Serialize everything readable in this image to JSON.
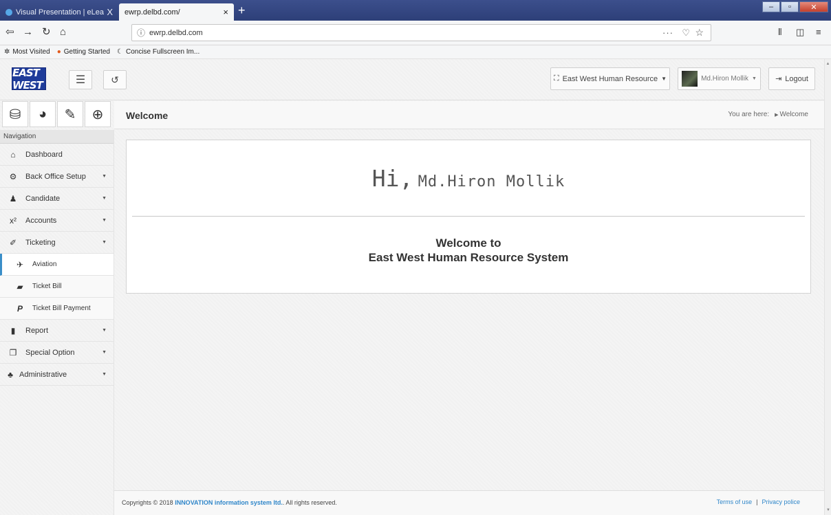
{
  "browser": {
    "tabs": [
      {
        "label": "Visual Presentation | eLearning",
        "close": "X"
      },
      {
        "label": "ewrp.delbd.com/",
        "close": "×"
      }
    ],
    "new_tab": "+",
    "url": "ewrp.delbd.com",
    "page_actions": "···",
    "bookmarks": [
      "Most Visited",
      "Getting Started",
      "Concise Fullscreen Im..."
    ]
  },
  "topbar": {
    "organization": "East West Human Resource",
    "user_name": "Md.Hiron Mollik",
    "logout_label": "Logout",
    "logo_text": "EAST WEST"
  },
  "sidebar": {
    "header": "Navigation",
    "items": [
      {
        "label": "Dashboard",
        "icon": "home-icon",
        "has_sub": false
      },
      {
        "label": "Back Office Setup",
        "icon": "cogs-icon",
        "has_sub": true
      },
      {
        "label": "Candidate",
        "icon": "candidate-icon",
        "has_sub": true
      },
      {
        "label": "Accounts",
        "icon": "superscript-icon",
        "has_sub": true
      },
      {
        "label": "Ticketing",
        "icon": "ticket-icon",
        "has_sub": true
      },
      {
        "label": "Aviation",
        "icon": "plane-icon",
        "sub": true,
        "active": true
      },
      {
        "label": "Ticket Bill",
        "icon": "briefcase-icon",
        "sub": true
      },
      {
        "label": "Ticket Bill Payment",
        "icon": "paypal-icon",
        "sub": true
      },
      {
        "label": "Report",
        "icon": "book-icon",
        "has_sub": true
      },
      {
        "label": "Special Option",
        "icon": "copy-icon",
        "has_sub": true
      },
      {
        "label": "Administrative",
        "icon": "users-icon",
        "has_sub": true
      }
    ]
  },
  "content": {
    "title": "Welcome",
    "breadcrumb_label": "You are here:",
    "breadcrumb_current": "Welcome",
    "greeting_hi": "Hi,",
    "greeting_name": "Md.Hiron Mollik",
    "welcome_line1": "Welcome to",
    "welcome_line2": "East West Human Resource System"
  },
  "footer": {
    "copy_prefix": "Copyrights © 2018",
    "company": "INNOVATION information system ltd.",
    "copy_suffix": ". All rights reserved.",
    "terms": "Terms of use",
    "separator": "|",
    "privacy": "Privacy police"
  },
  "colors": {
    "link": "#2f86c9",
    "active_border": "#3a8ec8",
    "titlebar": "#2d3f78"
  }
}
